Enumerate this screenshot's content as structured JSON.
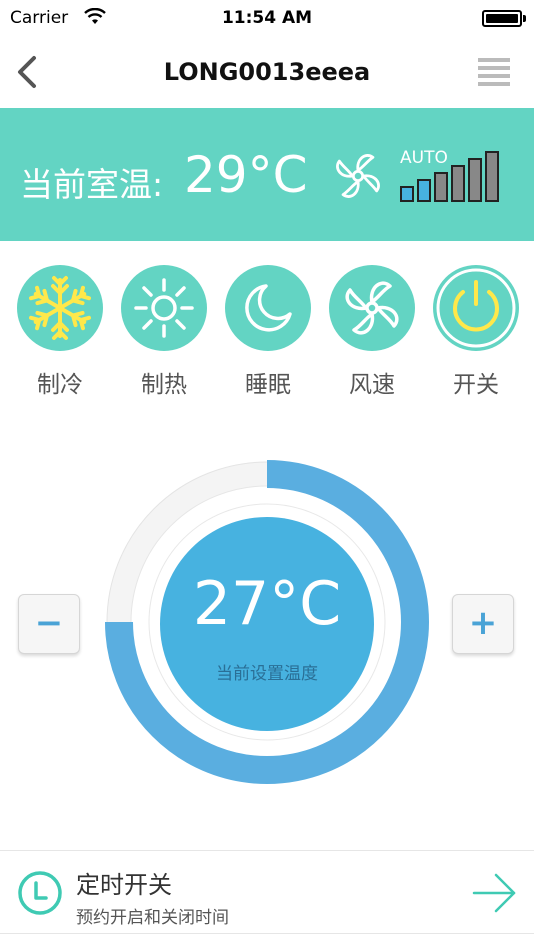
{
  "status_bar": {
    "carrier": "Carrier",
    "time": "11:54 AM"
  },
  "nav": {
    "title": "LONG0013eeea"
  },
  "banner": {
    "room_label": "当前室温:",
    "room_temp": "29°C",
    "fan_speed_label": "AUTO",
    "fan_speed_level": 2,
    "fan_speed_max": 6
  },
  "modes": [
    {
      "label": "制冷",
      "icon": "snowflake-icon"
    },
    {
      "label": "制热",
      "icon": "sun-icon"
    },
    {
      "label": "睡眠",
      "icon": "moon-icon"
    },
    {
      "label": "风速",
      "icon": "fan-icon"
    },
    {
      "label": "开关",
      "icon": "power-icon"
    }
  ],
  "dial": {
    "set_temp": "27°C",
    "set_label": "当前设置温度",
    "minus_label": "−",
    "plus_label": "+",
    "progress": 0.75
  },
  "timer": {
    "title": "定时开关",
    "subtitle": "预约开启和关闭时间"
  },
  "colors": {
    "teal": "#63d4c3",
    "blue": "#47b2e0",
    "arc": "#5aaee0",
    "active_icon": "#ffe84a",
    "timer_accent": "#3fcab3"
  }
}
